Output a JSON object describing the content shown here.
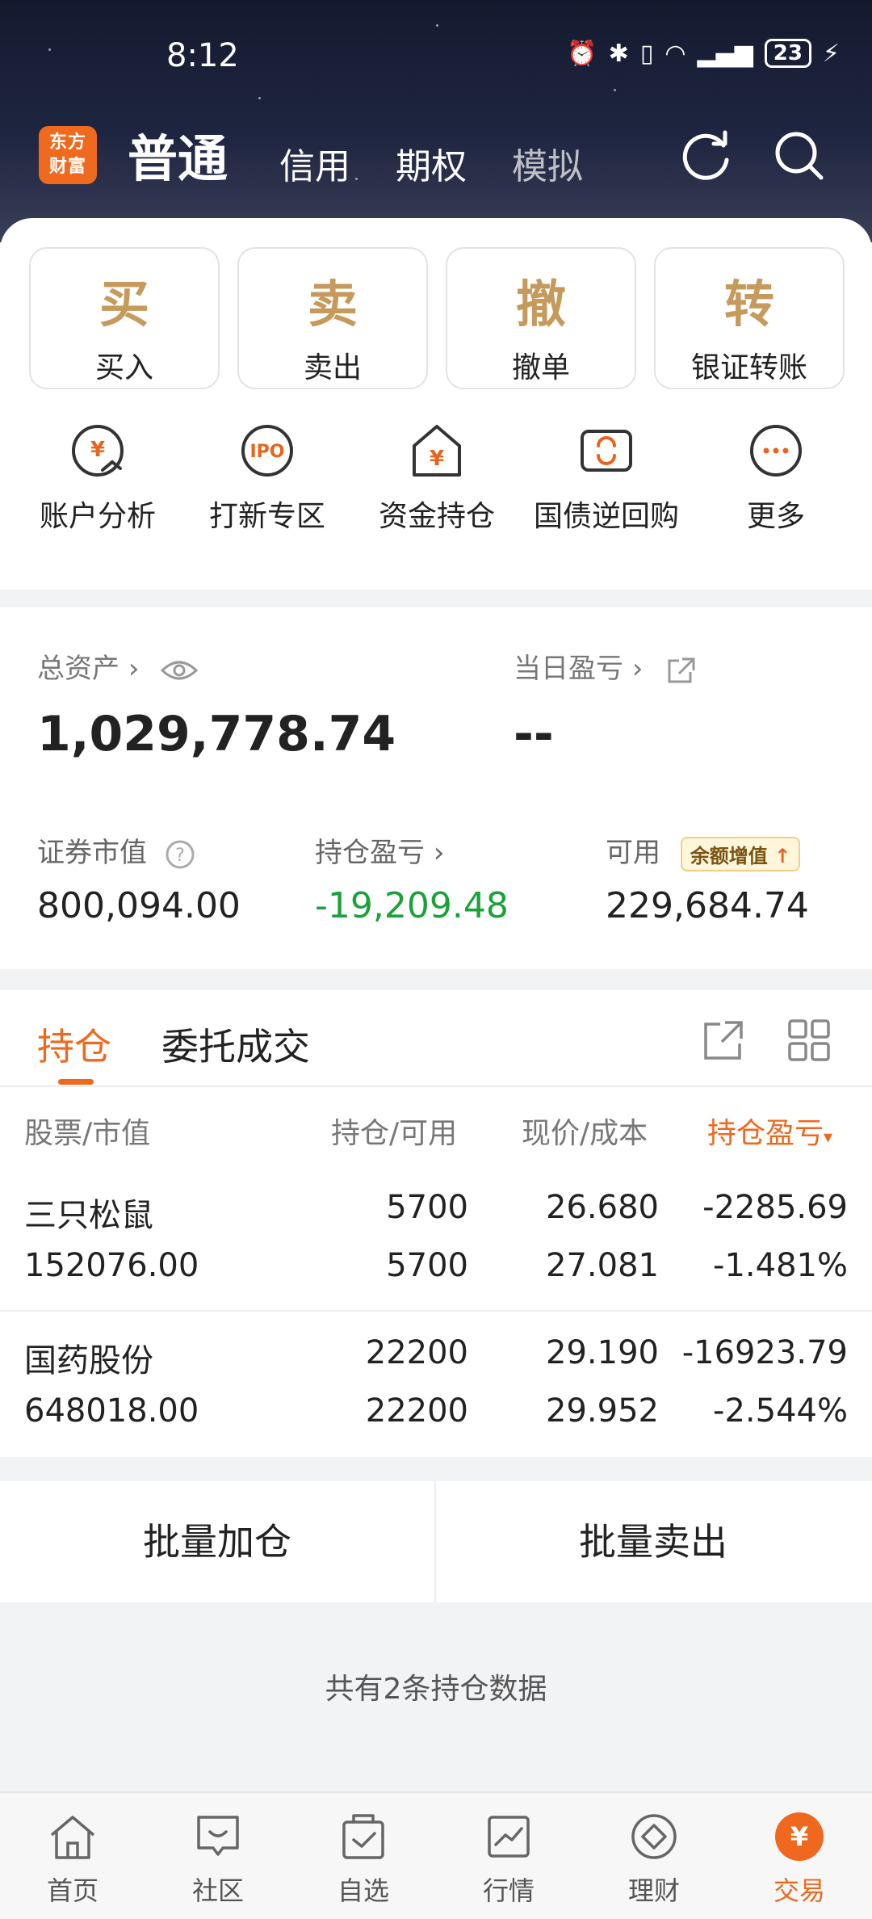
{
  "status_bar": {
    "time": "8:12",
    "battery": "23"
  },
  "header": {
    "logo_line1": "东方",
    "logo_line2": "财富",
    "tabs": [
      {
        "label": "普通"
      },
      {
        "label": "信用"
      },
      {
        "label": "期权"
      },
      {
        "label": "模拟"
      }
    ]
  },
  "quick_actions": [
    {
      "char": "买",
      "label": "买入"
    },
    {
      "char": "卖",
      "label": "卖出"
    },
    {
      "char": "撤",
      "label": "撤单"
    },
    {
      "char": "转",
      "label": "银证转账"
    }
  ],
  "functions": [
    {
      "label": "账户分析",
      "icon": "yuan-chart-icon"
    },
    {
      "label": "打新专区",
      "icon": "ipo-icon",
      "icon_text": "IPO"
    },
    {
      "label": "资金持仓",
      "icon": "yuan-house-icon"
    },
    {
      "label": "国债逆回购",
      "icon": "bond-repo-icon"
    },
    {
      "label": "更多",
      "icon": "more-icon"
    }
  ],
  "assets": {
    "total_label": "总资产",
    "total_value": "1,029,778.74",
    "daily_label": "当日盈亏",
    "daily_value": "--",
    "market_value_label": "证券市值",
    "market_value": "800,094.00",
    "pnl_label": "持仓盈亏",
    "pnl_value": "-19,209.48",
    "available_label": "可用",
    "available_badge": "余额增值",
    "available_value": "229,684.74"
  },
  "positions": {
    "tab_active": "持仓",
    "tab_other": "委托成交",
    "columns": [
      "股票/市值",
      "持仓/可用",
      "现价/成本",
      "持仓盈亏"
    ],
    "rows": [
      {
        "name": "三只松鼠",
        "market_value": "152076.00",
        "holding": "5700",
        "available": "5700",
        "price": "26.680",
        "cost": "27.081",
        "pnl": "-2285.69",
        "pnl_pct": "-1.481%"
      },
      {
        "name": "国药股份",
        "market_value": "648018.00",
        "holding": "22200",
        "available": "22200",
        "price": "29.190",
        "cost": "29.952",
        "pnl": "-16923.79",
        "pnl_pct": "-2.544%"
      }
    ]
  },
  "batch": {
    "add_label": "批量加仓",
    "sell_label": "批量卖出"
  },
  "summary": "共有2条持仓数据",
  "bottom_nav": [
    {
      "label": "首页"
    },
    {
      "label": "社区"
    },
    {
      "label": "自选"
    },
    {
      "label": "行情"
    },
    {
      "label": "理财"
    },
    {
      "label": "交易",
      "active": true
    }
  ],
  "colors": {
    "accent": "#f0681d",
    "gain_loss_green": "#1aa23a",
    "quick_gold": "#c59a5c"
  }
}
